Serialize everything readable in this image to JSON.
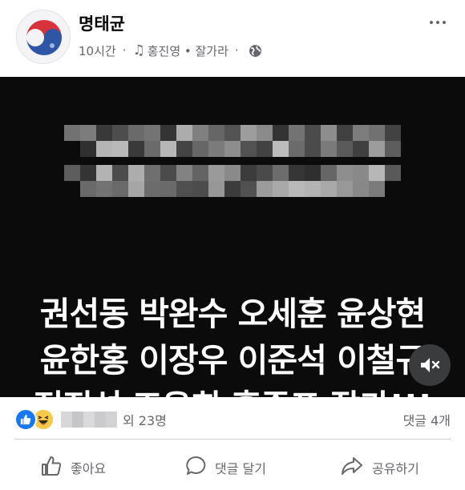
{
  "post": {
    "author": "명태균",
    "time": "10시간",
    "music": "홍진영 • 잘가라"
  },
  "media": {
    "overlay_lines": [
      "권선동 박완수 오세훈 윤상현",
      "윤한홍 이장우 이준석 이철규",
      "정진석 조은희 홍준표 잘가!!!"
    ],
    "muted": true
  },
  "reactions": {
    "others_text": "외 23명",
    "comments_text": "댓글 4개"
  },
  "actions": {
    "like": "좋아요",
    "comment": "댓글 달기",
    "share": "공유하기"
  },
  "icons": {
    "music": "music-note-icon",
    "privacy": "globe-icon",
    "more": "more-options-icon",
    "mute": "speaker-muted-icon",
    "like": "thumbs-up-icon",
    "comment": "speech-bubble-icon",
    "share": "share-arrow-icon"
  },
  "colors": {
    "facebook_blue": "#1877f2",
    "secondary_text": "#65676b",
    "media_background": "#0b0b0c"
  }
}
